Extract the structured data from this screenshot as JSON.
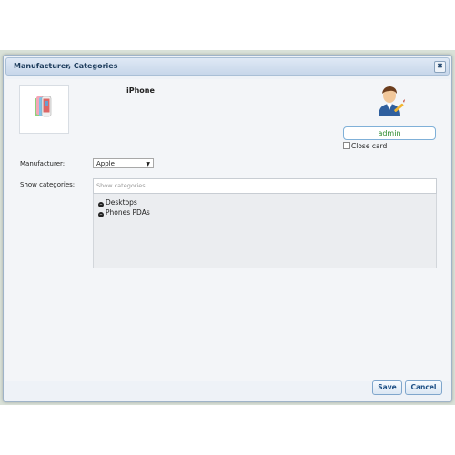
{
  "dialog": {
    "title": "Manufacturer, Categories",
    "close_glyph": "✖"
  },
  "product": {
    "name": "iPhone"
  },
  "user": {
    "name": "admin",
    "close_card_label": "Close card"
  },
  "form": {
    "manufacturer_label": "Manufacturer:",
    "manufacturer_value": "Apple",
    "categories_label": "Show categories:",
    "categories_placeholder": "Show categories"
  },
  "categories": [
    {
      "label": "Desktops"
    },
    {
      "label": "Phones PDAs"
    }
  ],
  "footer": {
    "save_label": "Save",
    "cancel_label": "Cancel"
  }
}
